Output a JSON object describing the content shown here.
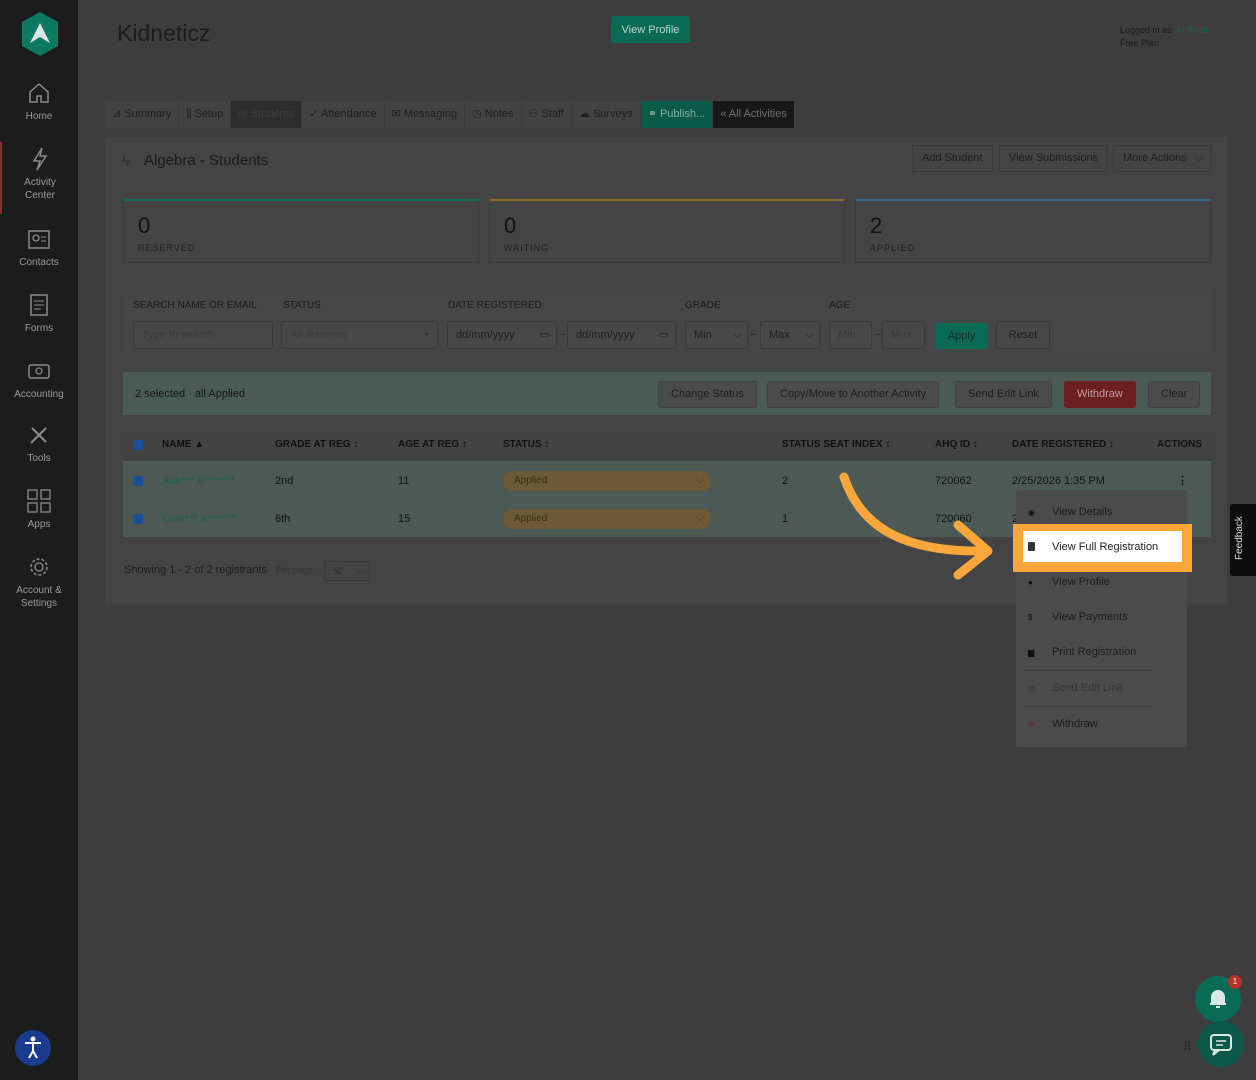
{
  "sidebar": {
    "items": [
      {
        "label": "Home"
      },
      {
        "label": "Activity Center"
      },
      {
        "label": "Contacts"
      },
      {
        "label": "Forms"
      },
      {
        "label": "Accounting"
      },
      {
        "label": "Tools"
      },
      {
        "label": "Apps"
      },
      {
        "label": "Account & Settings"
      }
    ]
  },
  "header": {
    "brand": "Kidneticz",
    "view_profile": "View Profile",
    "logged_in_label": "Logged in as:",
    "user": "Al Rhett",
    "plan": "Free Plan"
  },
  "tabs": [
    {
      "label": "Summary"
    },
    {
      "label": "Setup"
    },
    {
      "label": "Students"
    },
    {
      "label": "Attendance"
    },
    {
      "label": "Messaging"
    },
    {
      "label": "Notes"
    },
    {
      "label": "Staff"
    },
    {
      "label": "Surveys"
    },
    {
      "label": "Publish..."
    },
    {
      "label": "« All Activities"
    }
  ],
  "page": {
    "title": "Algebra - Students",
    "add_student": "Add Student",
    "view_submissions": "View Submissions",
    "more_actions": "More Actions"
  },
  "stats": [
    {
      "number": "0",
      "label": "RESERVED",
      "color": "#0e6e5a"
    },
    {
      "number": "0",
      "label": "WAITING",
      "color": "#8a6a2a"
    },
    {
      "number": "2",
      "label": "APPLIED",
      "color": "#2f6a86"
    }
  ],
  "filters": {
    "search_label": "SEARCH NAME OR EMAIL",
    "search_placeholder": "Type to search...",
    "status_label": "STATUS",
    "status_value": "All statuses",
    "date_label": "DATE REGISTERED",
    "date_from": "dd/mm/yyyy",
    "date_to": "dd/mm/yyyy",
    "grade_label": "GRADE",
    "grade_min": "Min",
    "grade_max": "Max",
    "age_label": "AGE",
    "age_min": "Min",
    "age_max": "Max",
    "apply": "Apply",
    "reset": "Reset"
  },
  "selection": {
    "text": "2 selected · all Applied",
    "change_status": "Change Status",
    "copy_move": "Copy/Move to Another Activity",
    "send_edit_link": "Send Edit Link",
    "withdraw": "Withdraw",
    "clear": "Clear"
  },
  "table": {
    "columns": [
      "NAME ▲",
      "GRADE AT REG ↕",
      "AGE AT REG ↕",
      "STATUS ↕",
      "STATUS SEAT INDEX ↕",
      "AHQ ID ↕",
      "DATE REGISTERED ↕",
      "ACTIONS"
    ],
    "rows": [
      {
        "name": "Anu*** B*******",
        "grade": "2nd",
        "age": "11",
        "status": "Applied",
        "seat": "2",
        "ahq": "720062",
        "date": "2/25/2026 1:35 PM"
      },
      {
        "name": "Cele*** A*******",
        "grade": "6th",
        "age": "15",
        "status": "Applied",
        "seat": "1",
        "ahq": "720060",
        "date": "2"
      }
    ]
  },
  "footer": {
    "showing": "Showing 1 - 2 of 2 registrants",
    "per_page_label": "Per page:",
    "per_page": "50"
  },
  "menu": {
    "items": [
      {
        "label": "View Details",
        "icon": "eye-icon"
      },
      {
        "label": "View Full Registration",
        "icon": "document-icon"
      },
      {
        "label": "View Profile",
        "icon": "user-icon"
      },
      {
        "label": "View Payments",
        "icon": "dollar-icon"
      },
      {
        "label": "Print Registration",
        "icon": "printer-icon"
      },
      {
        "label": "Send Edit Link",
        "icon": "envelope-icon"
      },
      {
        "label": "Withdraw",
        "icon": "minus-circle-icon"
      }
    ]
  },
  "feedback": "Feedback",
  "notifications": {
    "count": "1"
  },
  "colors": {
    "brand": "#0a6b55",
    "highlight": "#f9a63a",
    "withdraw": "#b8302b"
  }
}
